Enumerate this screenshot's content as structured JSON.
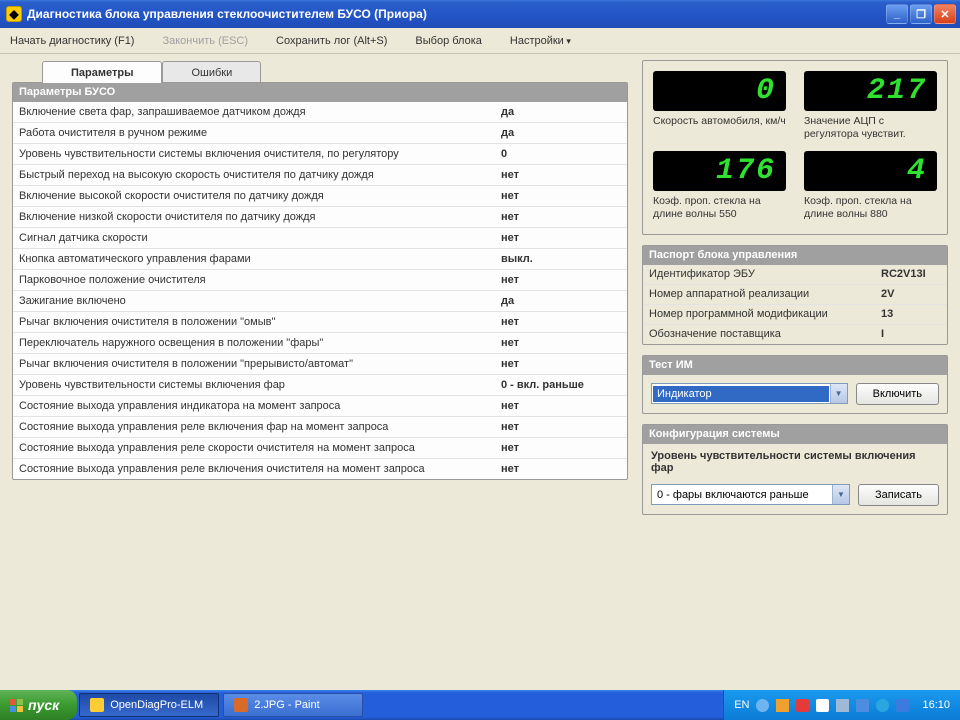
{
  "window": {
    "title": "Диагностика блока управления стеклоочистителем БУСО (Приора)"
  },
  "menu": {
    "start_diag": "Начать диагностику (F1)",
    "end_diag": "Закончить (ESC)",
    "save_log": "Сохранить лог (Alt+S)",
    "choose_block": "Выбор блока",
    "settings": "Настройки"
  },
  "tabs": {
    "params": "Параметры",
    "errors": "Ошибки"
  },
  "params_header": "Параметры БУСО",
  "params": [
    {
      "label": "Включение света фар, запрашиваемое датчиком дождя",
      "value": "да"
    },
    {
      "label": "Работа очистителя в ручном режиме",
      "value": "да"
    },
    {
      "label": "Уровень чувствительности системы включения очистителя, по регулятору",
      "value": "0"
    },
    {
      "label": "Быстрый переход на высокую скорость очистителя по датчику дождя",
      "value": "нет"
    },
    {
      "label": "Включение высокой скорости очистителя по датчику дождя",
      "value": "нет"
    },
    {
      "label": "Включение низкой скорости очистителя по датчику дождя",
      "value": "нет"
    },
    {
      "label": "Сигнал датчика скорости",
      "value": "нет"
    },
    {
      "label": "Кнопка автоматического управления фарами",
      "value": "выкл."
    },
    {
      "label": "Парковочное положение очистителя",
      "value": "нет"
    },
    {
      "label": "Зажигание включено",
      "value": "да"
    },
    {
      "label": "Рычаг включения очистителя в положении \"омыв\"",
      "value": "нет"
    },
    {
      "label": "Переключатель наружного освещения в положении \"фары\"",
      "value": "нет"
    },
    {
      "label": "Рычаг включения очистителя в положении \"прерывисто/автомат\"",
      "value": "нет"
    },
    {
      "label": "Уровень чувствительности системы включения фар",
      "value": "0 - вкл. раньше"
    },
    {
      "label": "Состояние выхода управления индикатора на момент запроса",
      "value": "нет"
    },
    {
      "label": "Состояние выхода управления реле включения фар на момент запроса",
      "value": "нет"
    },
    {
      "label": "Состояние выхода управления реле скорости очистителя на момент запроса",
      "value": "нет"
    },
    {
      "label": "Состояние выхода управления реле включения очистителя на момент запроса",
      "value": "нет"
    }
  ],
  "gauges": {
    "speed": {
      "value": "0",
      "caption": "Скорость автомобиля, км/ч"
    },
    "adc": {
      "value": "217",
      "caption": "Значение АЦП с регулятора чувствит."
    },
    "k550": {
      "value": "176",
      "caption": "Коэф. проп. стекла на длине волны 550"
    },
    "k880": {
      "value": "4",
      "caption": "Коэф. проп. стекла на длине волны 880"
    }
  },
  "passport": {
    "header": "Паспорт блока управления",
    "rows": [
      {
        "label": "Идентификатор ЭБУ",
        "value": "RC2V13I"
      },
      {
        "label": "Номер аппаратной реализации",
        "value": "2V"
      },
      {
        "label": "Номер программной модификации",
        "value": "13"
      },
      {
        "label": "Обозначение поставщика",
        "value": "I"
      }
    ]
  },
  "test": {
    "header": "Тест ИМ",
    "selected": "Индикатор",
    "button": "Включить"
  },
  "config": {
    "header": "Конфигурация системы",
    "label": "Уровень чувствительности системы включения фар",
    "selected": "0 - фары включаются раньше",
    "button": "Записать"
  },
  "taskbar": {
    "start": "пуск",
    "apps": [
      {
        "name": "OpenDiagPro-ELM"
      },
      {
        "name": "2.JPG - Paint"
      }
    ],
    "lang": "EN",
    "clock": "16:10"
  }
}
